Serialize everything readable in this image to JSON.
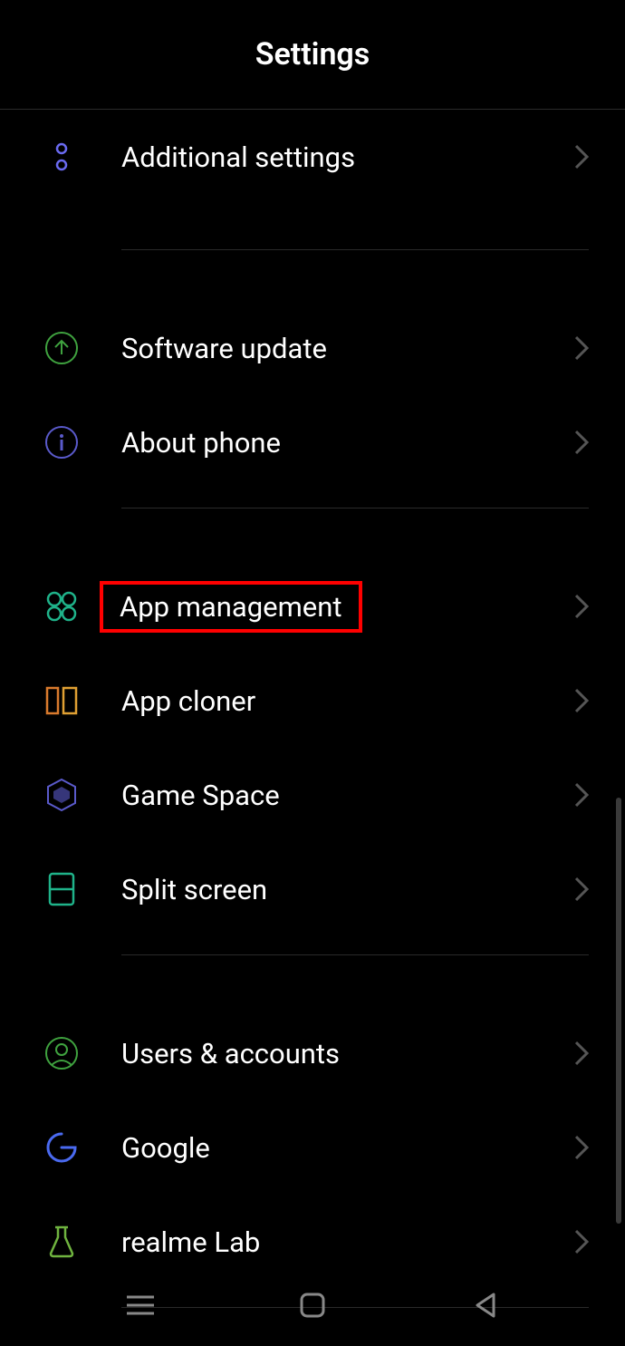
{
  "header": {
    "title": "Settings"
  },
  "items": [
    {
      "label": "Additional settings"
    },
    {
      "label": "Software update"
    },
    {
      "label": "About phone"
    },
    {
      "label": "App management"
    },
    {
      "label": "App cloner"
    },
    {
      "label": "Game Space"
    },
    {
      "label": "Split screen"
    },
    {
      "label": "Users & accounts"
    },
    {
      "label": "Google"
    },
    {
      "label": "realme Lab"
    }
  ]
}
